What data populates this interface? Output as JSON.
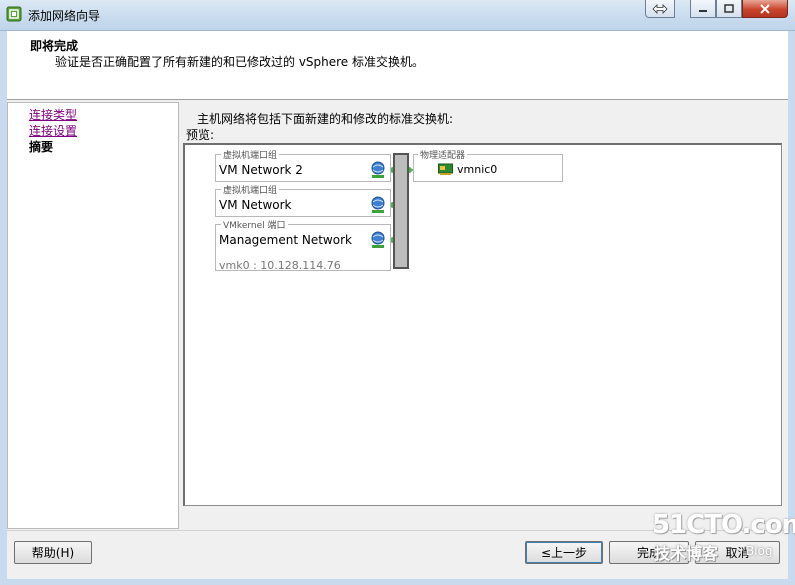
{
  "window": {
    "title": "添加网络向导",
    "controls": [
      "restore",
      "minimize",
      "maximize",
      "close"
    ]
  },
  "header": {
    "title": "即将完成",
    "description": "验证是否正确配置了所有新建的和已修改过的 vSphere 标准交换机。"
  },
  "nav": {
    "links": [
      "连接类型",
      "连接设置"
    ],
    "current": "摘要"
  },
  "main": {
    "description": "主机网络将包括下面新建的和修改的标准交换机:",
    "preview_label": "预览:",
    "port_groups": [
      {
        "legend": "虚拟机端口组",
        "name": "VM Network 2"
      },
      {
        "legend": "虚拟机端口组",
        "name": "VM Network"
      },
      {
        "legend": "VMkernel 端口",
        "name": "Management Network",
        "sub": "vmk0 : 10.128.114.76"
      }
    ],
    "adapters": {
      "legend": "物理适配器",
      "items": [
        "vmnic0"
      ]
    }
  },
  "buttons": {
    "help": "帮助(H)",
    "back": "≤上一步",
    "finish": "完成",
    "cancel": "取消"
  },
  "watermark": {
    "big": "51CTO.com",
    "small": "技术博客",
    "blog": "Blog"
  },
  "colors": {
    "titlebar": "#c8dbee",
    "visited_link": "#800080",
    "switch_bar": "#bdbdbd",
    "connector": "#4caf50"
  }
}
